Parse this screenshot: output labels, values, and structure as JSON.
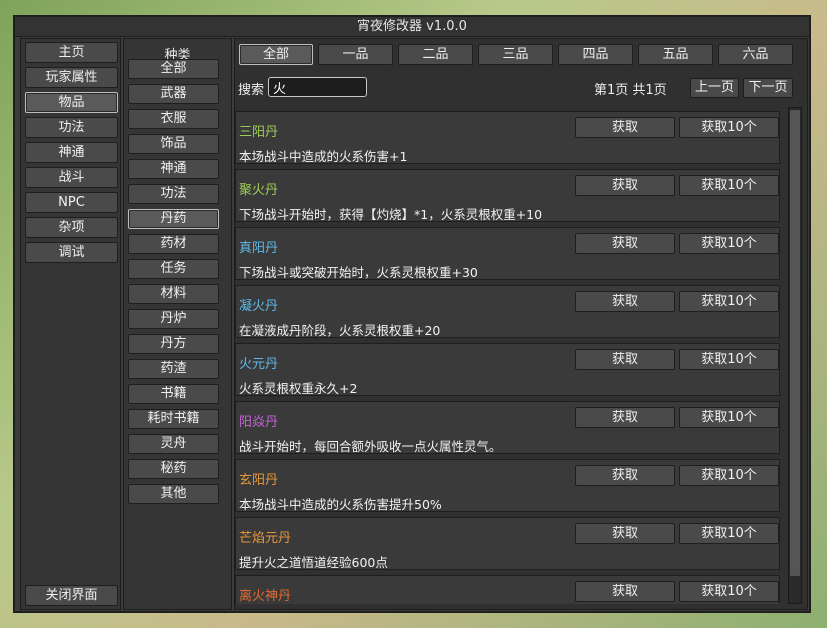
{
  "title": "宵夜修改器 v1.0.0",
  "nav": [
    {
      "label": "主页"
    },
    {
      "label": "玩家属性"
    },
    {
      "label": "物品",
      "selected": true
    },
    {
      "label": "功法"
    },
    {
      "label": "神通"
    },
    {
      "label": "战斗"
    },
    {
      "label": "NPC"
    },
    {
      "label": "杂项"
    },
    {
      "label": "调试"
    }
  ],
  "close_label": "关闭界面",
  "category_header": "种类",
  "categories": [
    {
      "label": "全部"
    },
    {
      "label": "武器"
    },
    {
      "label": "衣服"
    },
    {
      "label": "饰品"
    },
    {
      "label": "神通"
    },
    {
      "label": "功法"
    },
    {
      "label": "丹药",
      "selected": true
    },
    {
      "label": "药材"
    },
    {
      "label": "任务"
    },
    {
      "label": "材料"
    },
    {
      "label": "丹炉"
    },
    {
      "label": "丹方"
    },
    {
      "label": "药渣"
    },
    {
      "label": "书籍"
    },
    {
      "label": "耗时书籍"
    },
    {
      "label": "灵舟"
    },
    {
      "label": "秘药"
    },
    {
      "label": "其他"
    }
  ],
  "grades": [
    {
      "label": "全部",
      "selected": true
    },
    {
      "label": "一品"
    },
    {
      "label": "二品"
    },
    {
      "label": "三品"
    },
    {
      "label": "四品"
    },
    {
      "label": "五品"
    },
    {
      "label": "六品"
    }
  ],
  "search": {
    "label": "搜索",
    "value": "火"
  },
  "pagination": {
    "text": "第1页 共1页",
    "prev": "上一页",
    "next": "下一页"
  },
  "buttons": {
    "get": "获取",
    "get10": "获取10个"
  },
  "items": [
    {
      "name": "三阳丹",
      "desc": "本场战斗中造成的火系伤害+1",
      "color": "#9ccf55"
    },
    {
      "name": "聚火丹",
      "desc": "下场战斗开始时，获得【灼烧】*1，火系灵根权重+10",
      "color": "#9ccf55"
    },
    {
      "name": "真阳丹",
      "desc": "下场战斗或突破开始时，火系灵根权重+30",
      "color": "#5fb9e8"
    },
    {
      "name": "凝火丹",
      "desc": "在凝液成丹阶段，火系灵根权重+20",
      "color": "#5fb9e8"
    },
    {
      "name": "火元丹",
      "desc": "火系灵根权重永久+2",
      "color": "#5fb9e8"
    },
    {
      "name": "阳焱丹",
      "desc": "战斗开始时，每回合额外吸收一点火属性灵气。",
      "color": "#c466d6"
    },
    {
      "name": "玄阳丹",
      "desc": "本场战斗中造成的火系伤害提升50%",
      "color": "#e8973a"
    },
    {
      "name": "芒焰元丹",
      "desc": "提升火之道悟道经验600点",
      "color": "#e8973a"
    },
    {
      "name": "离火神丹",
      "desc": "",
      "color": "#e06a2e"
    }
  ],
  "colors": {
    "window_bg": "#3c3c3c",
    "panel_bg": "#353535",
    "button_bg": "#4a4a4a"
  }
}
